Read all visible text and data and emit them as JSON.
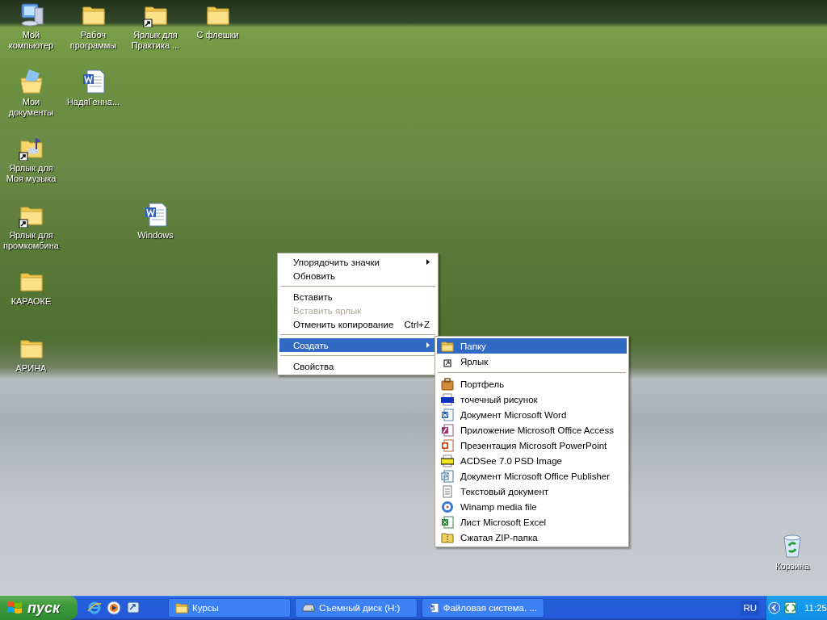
{
  "desktop_icons": [
    {
      "kind": "computer",
      "label": "Мой компьютер",
      "shortcut": false
    },
    {
      "kind": "documents",
      "label": "Мои документы",
      "shortcut": false
    },
    {
      "kind": "music",
      "label": "Ярлык для Моя музыка",
      "shortcut": true
    },
    {
      "kind": "folder",
      "label": "Ярлык для промкомбина",
      "shortcut": true
    },
    {
      "kind": "folder",
      "label": "КАРАОКЕ",
      "shortcut": false
    },
    {
      "kind": "folder",
      "label": "АРИНА",
      "shortcut": false
    },
    {
      "kind": "folder",
      "label": "Рабоч программы",
      "shortcut": false
    },
    {
      "kind": "word",
      "label": "НадяГенна...",
      "shortcut": false
    },
    {
      "kind": "folder",
      "label": "Ярлык для Практика ...",
      "shortcut": true
    },
    {
      "kind": "word",
      "label": "Windows",
      "shortcut": false
    },
    {
      "kind": "folder",
      "label": "С флешки",
      "shortcut": false
    }
  ],
  "recycle_bin": {
    "label": "Корзина"
  },
  "context_menu": {
    "items": [
      {
        "kind": "item",
        "label": "Упорядочить значки",
        "submenu": true,
        "disabled": false,
        "selected": false
      },
      {
        "kind": "item",
        "label": "Обновить",
        "submenu": false,
        "disabled": false,
        "selected": false
      },
      {
        "kind": "separator"
      },
      {
        "kind": "item",
        "label": "Вставить",
        "submenu": false,
        "disabled": false,
        "selected": false
      },
      {
        "kind": "item",
        "label": "Вставить ярлык",
        "submenu": false,
        "disabled": true,
        "selected": false
      },
      {
        "kind": "item",
        "label": "Отменить копирование",
        "shortcut": "Ctrl+Z",
        "submenu": false,
        "disabled": false,
        "selected": false
      },
      {
        "kind": "separator"
      },
      {
        "kind": "item",
        "label": "Создать",
        "submenu": true,
        "disabled": false,
        "selected": true
      },
      {
        "kind": "separator"
      },
      {
        "kind": "item",
        "label": "Свойства",
        "submenu": false,
        "disabled": false,
        "selected": false
      }
    ]
  },
  "new_submenu": {
    "items": [
      {
        "kind": "folder",
        "label": "Папку",
        "selected": true
      },
      {
        "kind": "shortcut",
        "label": "Ярлык",
        "selected": false
      },
      {
        "kind": "separator"
      },
      {
        "kind": "briefcase",
        "label": "Портфель",
        "selected": false
      },
      {
        "kind": "bitmap",
        "label": "точечный рисунок",
        "selected": false
      },
      {
        "kind": "word",
        "label": "Документ Microsoft Word",
        "selected": false
      },
      {
        "kind": "access",
        "label": "Приложение Microsoft Office Access",
        "selected": false
      },
      {
        "kind": "powerpoint",
        "label": "Презентация Microsoft PowerPoint",
        "selected": false
      },
      {
        "kind": "psd",
        "label": "ACDSee 7.0 PSD Image",
        "selected": false
      },
      {
        "kind": "publisher",
        "label": "Документ Microsoft Office Publisher",
        "selected": false
      },
      {
        "kind": "text",
        "label": "Текстовый документ",
        "selected": false
      },
      {
        "kind": "media",
        "label": "Winamp media file",
        "selected": false
      },
      {
        "kind": "excel",
        "label": "Лист Microsoft Excel",
        "selected": false
      },
      {
        "kind": "zip",
        "label": "Сжатая ZIP-папка",
        "selected": false
      }
    ]
  },
  "taskbar": {
    "start_button": "пуск",
    "tasks": [
      {
        "kind": "folder",
        "label": "Курсы"
      },
      {
        "kind": "drive",
        "label": "Съемный диск (H:)"
      },
      {
        "kind": "word",
        "label": "Файловая система. ..."
      }
    ],
    "language": "RU",
    "clock": "11:25"
  }
}
